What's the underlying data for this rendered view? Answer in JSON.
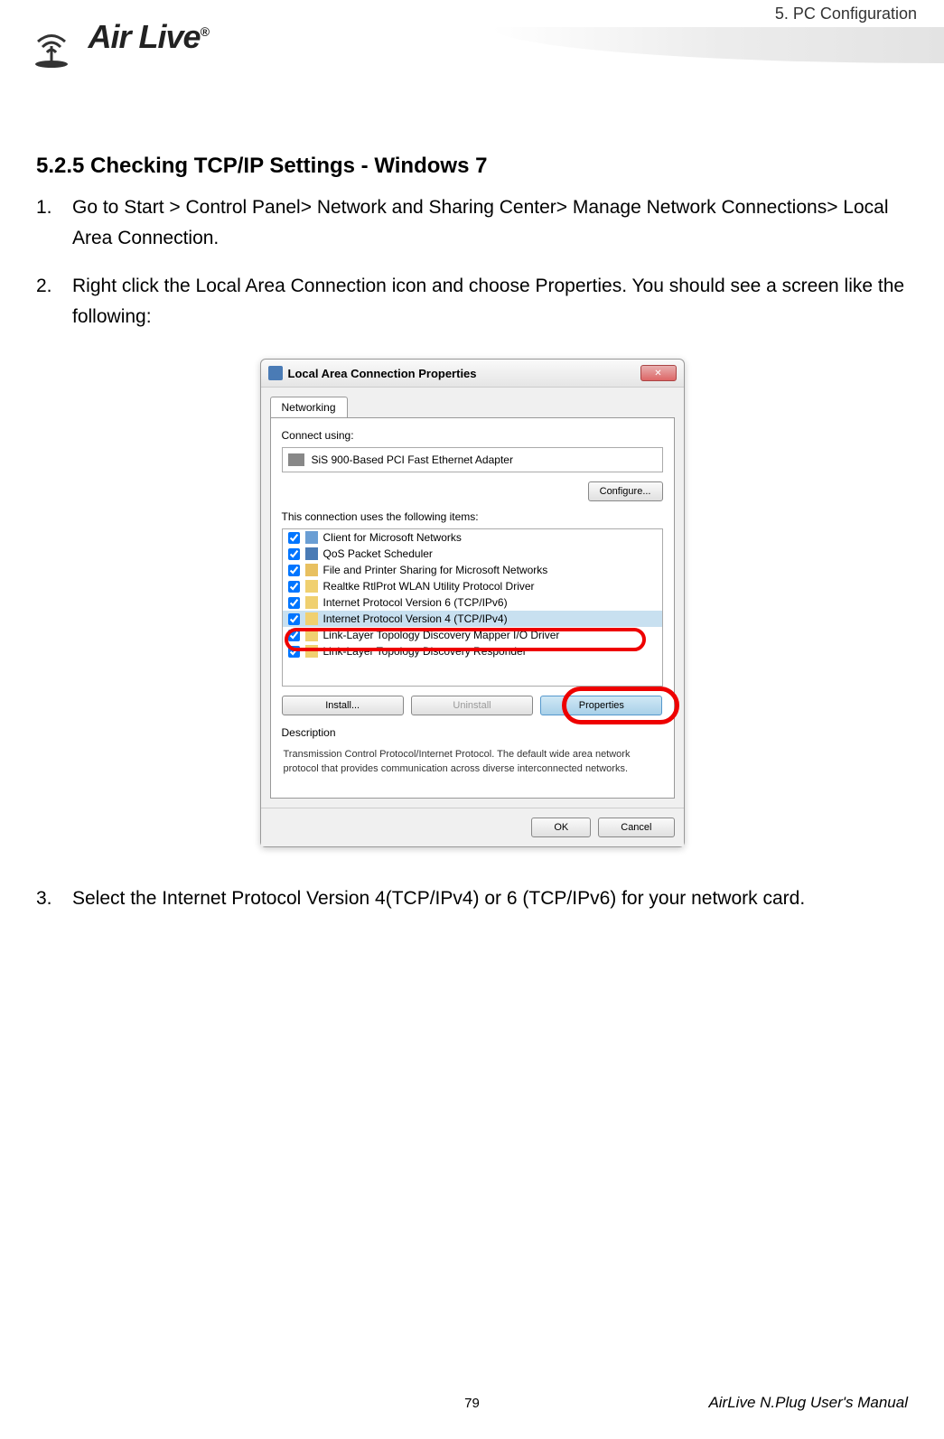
{
  "header": {
    "chapter_label": "5.  PC  Configuration",
    "logo_text": "Air Live",
    "reg_mark": "®"
  },
  "content": {
    "section_heading": "5.2.5 Checking TCP/IP Settings - Windows 7",
    "steps": [
      {
        "num": "1.",
        "text": "Go to Start > Control Panel> Network and Sharing Center> Manage Network Connections> Local Area Connection."
      },
      {
        "num": "2.",
        "text": "Right click the Local Area Connection icon and choose Properties. You should see a screen like the following:"
      },
      {
        "num": "3.",
        "text": "Select the Internet Protocol Version 4(TCP/IPv4) or 6 (TCP/IPv6) for your network card."
      }
    ]
  },
  "dialog": {
    "title": "Local Area Connection Properties",
    "tab_label": "Networking",
    "connect_using_label": "Connect using:",
    "adapter_name": "SiS 900-Based PCI Fast Ethernet Adapter",
    "configure_btn": "Configure...",
    "items_label": "This connection uses the following items:",
    "items": [
      {
        "label": "Client for Microsoft Networks",
        "icon": "client",
        "checked": true
      },
      {
        "label": "QoS Packet Scheduler",
        "icon": "sched",
        "checked": true
      },
      {
        "label": "File and Printer Sharing for Microsoft Networks",
        "icon": "file",
        "checked": true
      },
      {
        "label": "Realtke RtlProt WLAN Utility Protocol Driver",
        "icon": "proto",
        "checked": true
      },
      {
        "label": "Internet Protocol Version 6 (TCP/IPv6)",
        "icon": "proto",
        "checked": true
      },
      {
        "label": "Internet Protocol Version 4 (TCP/IPv4)",
        "icon": "proto",
        "checked": true,
        "selected": true
      },
      {
        "label": "Link-Layer Topology Discovery Mapper I/O Driver",
        "icon": "proto",
        "checked": true
      },
      {
        "label": "Link-Layer Topology Discovery Responder",
        "icon": "proto",
        "checked": true
      }
    ],
    "install_btn": "Install...",
    "uninstall_btn": "Uninstall",
    "properties_btn": "Properties",
    "description_label": "Description",
    "description_text": "Transmission Control Protocol/Internet Protocol. The default wide area network protocol that provides communication across diverse interconnected networks.",
    "ok_btn": "OK",
    "cancel_btn": "Cancel"
  },
  "footer": {
    "page_number": "79",
    "manual_label": "AirLive N.Plug User's Manual"
  }
}
